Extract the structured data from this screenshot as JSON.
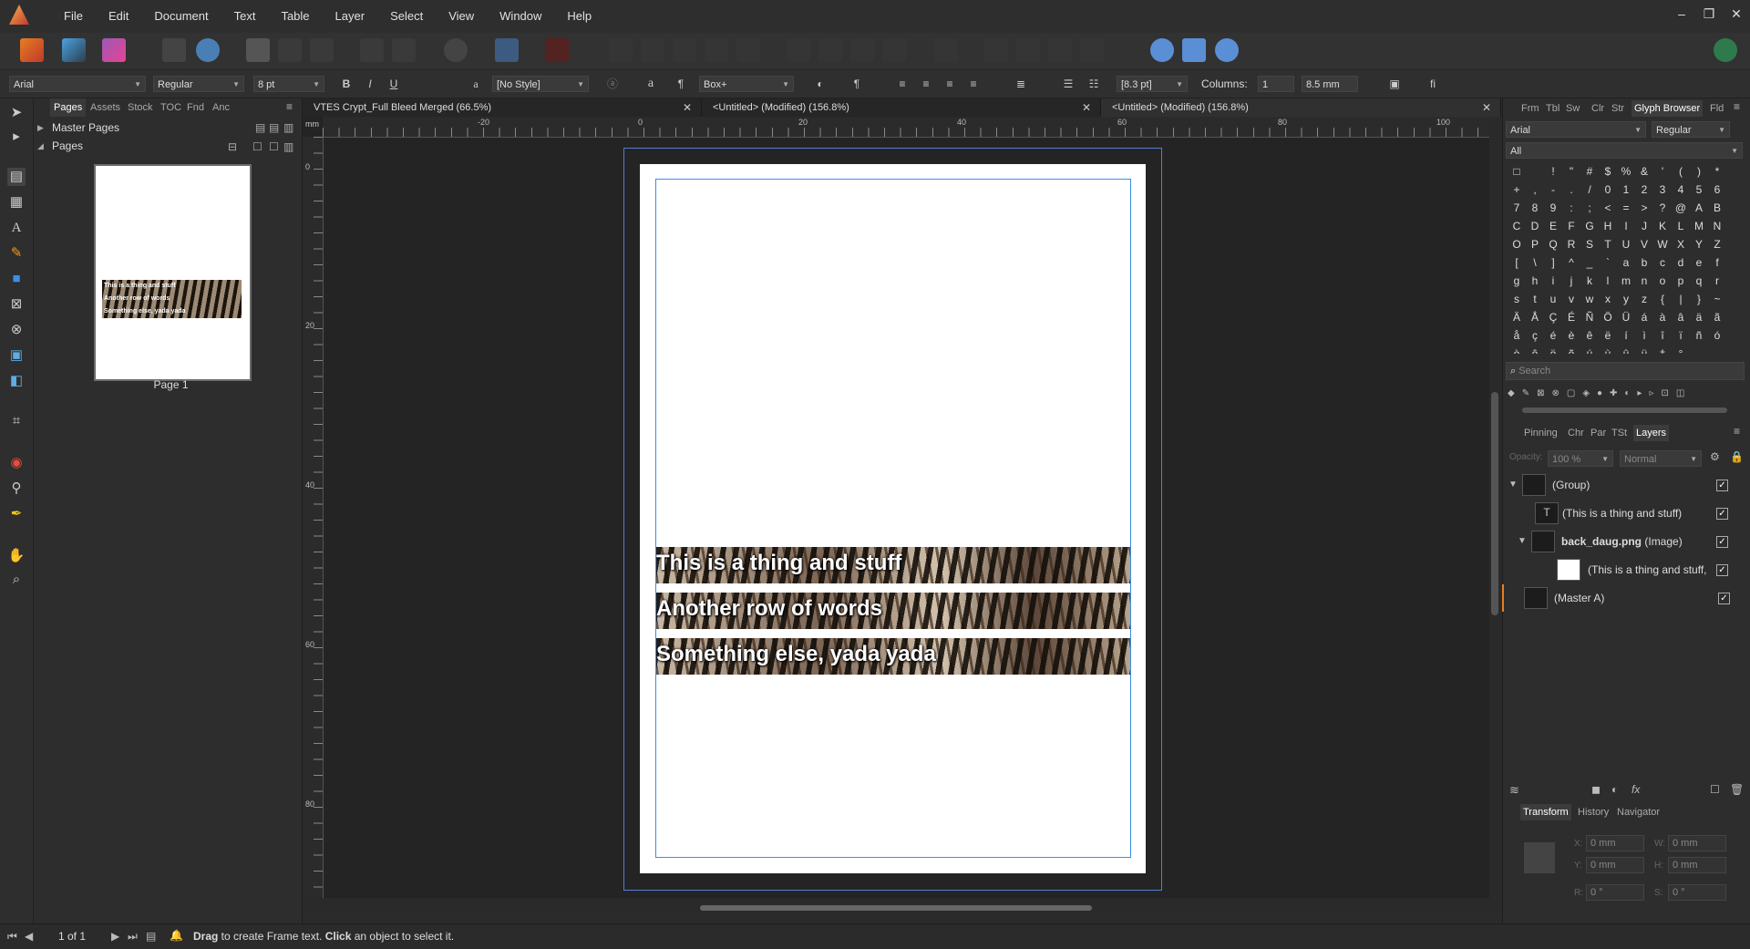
{
  "menubar": {
    "items": [
      "File",
      "Edit",
      "Document",
      "Text",
      "Table",
      "Layer",
      "Select",
      "View",
      "Window",
      "Help"
    ],
    "window_controls": [
      "–",
      "❐",
      "✕"
    ]
  },
  "context": {
    "font": "Arial",
    "style": "Regular",
    "size": "8 pt",
    "bold": "B",
    "italic": "I",
    "underline": "U",
    "char_style_glyph": "a",
    "para_mark": "¶",
    "text_style": "[No Style]",
    "char_a": "a",
    "frame_type": "Box+",
    "leading": "[8.3 pt]",
    "columns_label": "Columns:",
    "columns_value": "1",
    "gutter": "8.5 mm",
    "fi_glyph": "fi"
  },
  "pages_panel": {
    "tabs": [
      "Pages",
      "Assets",
      "Stock",
      "TOC",
      "Fnd",
      "Anc"
    ],
    "master_pages": "Master Pages",
    "pages": "Pages",
    "page_label": "Page 1",
    "thumb_lines": [
      "This is a thing and stuff",
      "Another row of words",
      "Something else, yada yada"
    ]
  },
  "doc_tabs": [
    {
      "title": "VTES Crypt_Full Bleed Merged (66.5%)"
    },
    {
      "title": "<Untitled> (Modified) (156.8%)"
    },
    {
      "title": "<Untitled> (Modified) (156.8%)"
    }
  ],
  "ruler": {
    "top": [
      "-20",
      "0",
      "20",
      "40",
      "60",
      "80",
      "100"
    ],
    "left": [
      "0",
      "20",
      "40",
      "60",
      "80"
    ],
    "unit": "mm"
  },
  "page_text": {
    "line1": "This is a thing and stuff",
    "line2": "Another row of words",
    "line3": "Something else, yada yada"
  },
  "right_panel": {
    "tabs_top": [
      "Frm",
      "Tbl",
      "Sw",
      "Clr",
      "Str",
      "Glyph Browser",
      "Fld"
    ],
    "glyph_font": "Arial",
    "glyph_style": "Regular",
    "glyph_subset": "All",
    "glyphs": [
      "□",
      " ",
      "!",
      "\"",
      "#",
      "$",
      "%",
      "&",
      "'",
      "(",
      ")",
      "*",
      "+",
      ",",
      "-",
      ".",
      "/",
      "0",
      "1",
      "2",
      "3",
      "4",
      "5",
      "6",
      "7",
      "8",
      "9",
      ":",
      ";",
      "<",
      "=",
      ">",
      "?",
      "@",
      "A",
      "B",
      "C",
      "D",
      "E",
      "F",
      "G",
      "H",
      "I",
      "J",
      "K",
      "L",
      "M",
      "N",
      "O",
      "P",
      "Q",
      "R",
      "S",
      "T",
      "U",
      "V",
      "W",
      "X",
      "Y",
      "Z",
      "[",
      "\\",
      "]",
      "^",
      "_",
      "`",
      "a",
      "b",
      "c",
      "d",
      "e",
      "f",
      "g",
      "h",
      "i",
      "j",
      "k",
      "l",
      "m",
      "n",
      "o",
      "p",
      "q",
      "r",
      "s",
      "t",
      "u",
      "v",
      "w",
      "x",
      "y",
      "z",
      "{",
      "|",
      "}",
      "~",
      "Ä",
      "Å",
      "Ç",
      "É",
      "Ñ",
      "Ö",
      "Ü",
      "á",
      "à",
      "â",
      "ä",
      "ã",
      "å",
      "ç",
      "é",
      "è",
      "ê",
      "ë",
      "í",
      "ì",
      "î",
      "ï",
      "ñ",
      "ó",
      "ò",
      "ô",
      "ö",
      "õ",
      "ú",
      "ù",
      "û",
      "ü",
      "†",
      "°"
    ],
    "search_placeholder": "Search",
    "layer_tabs": [
      "Pinning",
      "Chr",
      "Par",
      "TSt",
      "Layers"
    ],
    "opacity_label": "Opacity:",
    "opacity": "100 %",
    "blend": "Normal",
    "layers": [
      {
        "name": "(Group)"
      },
      {
        "name": "(This is a thing and stuff)"
      },
      {
        "name": "back_daug.png",
        "kind": "(Image)"
      },
      {
        "name": "(This is a thing and stuff,"
      },
      {
        "name": "(Master A)"
      }
    ],
    "bottom_tabs": [
      "Transform",
      "History",
      "Navigator"
    ],
    "transform": {
      "x": "0 mm",
      "y": "0 mm",
      "w": "0 mm",
      "h": "0 mm",
      "r": "0 °",
      "s": "0 °"
    },
    "transform_labels": {
      "x": "X:",
      "y": "Y:",
      "w": "W:",
      "h": "H:",
      "r": "R:",
      "s": "S:"
    }
  },
  "status": {
    "page_of": "1 of 1",
    "drag": "Drag",
    "msg1": " to create Frame text. ",
    "click": "Click",
    "msg2": " an object to select it."
  },
  "colors": {
    "accent": "#3a8ee6",
    "bg": "#2b2b2b",
    "canvas": "#242424"
  }
}
